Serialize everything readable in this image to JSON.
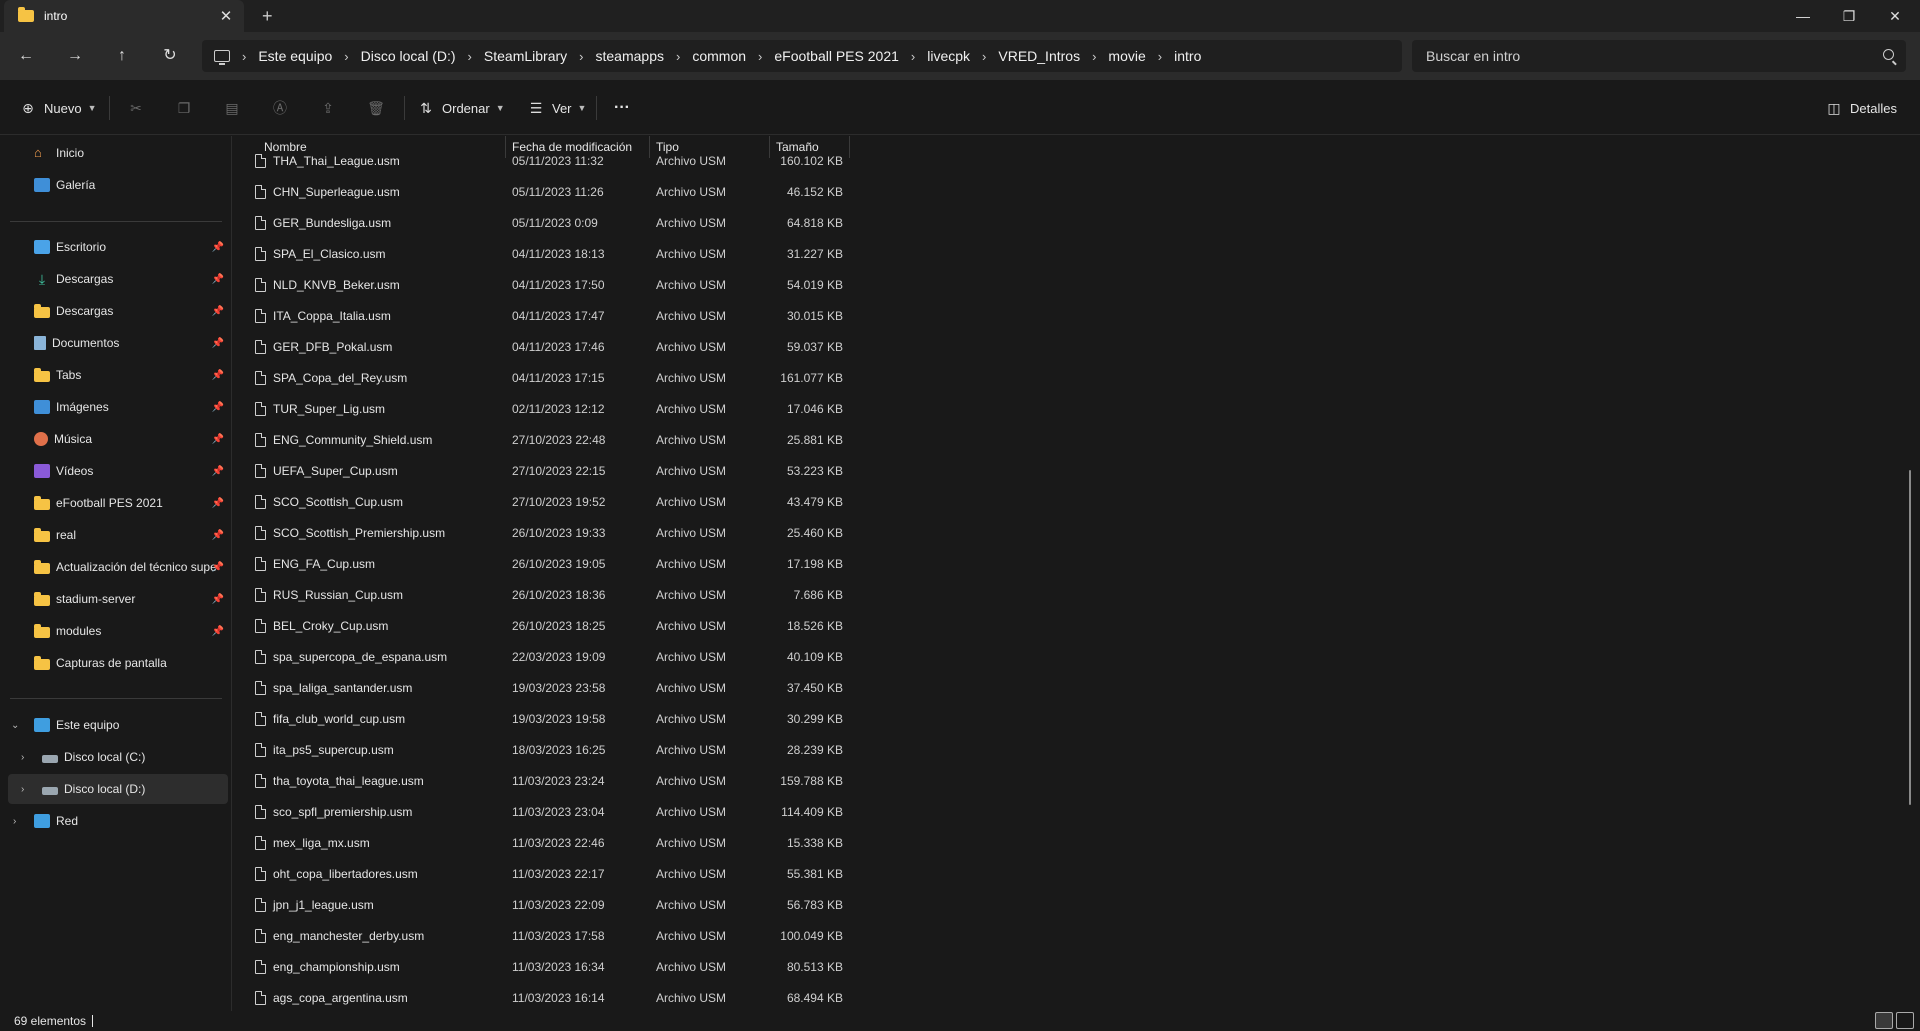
{
  "window": {
    "tab_title": "intro",
    "tab_close": "✕",
    "new_tab": "+",
    "minimize": "—",
    "maximize": "❐",
    "close": "✕"
  },
  "nav": {
    "back": "←",
    "forward": "→",
    "up": "↑",
    "refresh": "↻",
    "breadcrumbs": [
      "Este equipo",
      "Disco local (D:)",
      "SteamLibrary",
      "steamapps",
      "common",
      "eFootball PES 2021",
      "livecpk",
      "VRED_Intros",
      "movie",
      "intro"
    ],
    "search_placeholder": "Buscar en intro"
  },
  "toolbar": {
    "new_label": "Nuevo",
    "sort_label": "Ordenar",
    "view_label": "Ver",
    "more_label": "···",
    "details_label": "Detalles"
  },
  "sidebar": {
    "top": [
      {
        "label": "Inicio",
        "icon": "home-icon"
      },
      {
        "label": "Galería",
        "icon": "gallery-icon"
      }
    ],
    "quick": [
      {
        "label": "Escritorio",
        "icon": "desktop-icon"
      },
      {
        "label": "Descargas",
        "icon": "download-icon"
      },
      {
        "label": "Descargas",
        "icon": "folder-icon"
      },
      {
        "label": "Documentos",
        "icon": "documents-icon"
      },
      {
        "label": "Tabs",
        "icon": "folder-icon"
      },
      {
        "label": "Imágenes",
        "icon": "pictures-icon"
      },
      {
        "label": "Música",
        "icon": "music-icon"
      },
      {
        "label": "Vídeos",
        "icon": "videos-icon"
      },
      {
        "label": "eFootball PES 2021",
        "icon": "folder-icon"
      },
      {
        "label": "real",
        "icon": "folder-icon"
      },
      {
        "label": "Actualización del técnico supe",
        "icon": "folder-icon"
      },
      {
        "label": "stadium-server",
        "icon": "folder-icon"
      },
      {
        "label": "modules",
        "icon": "folder-icon"
      },
      {
        "label": "Capturas de pantalla",
        "icon": "folder-icon"
      }
    ],
    "tree": [
      {
        "label": "Este equipo",
        "icon": "pc-icon"
      },
      {
        "label": "Disco local (C:)",
        "icon": "drive-icon"
      },
      {
        "label": "Disco local (D:)",
        "icon": "drive-icon"
      },
      {
        "label": "Red",
        "icon": "network-icon"
      }
    ]
  },
  "columns": {
    "name": "Nombre",
    "date": "Fecha de modificación",
    "type": "Tipo",
    "size": "Tamaño"
  },
  "files": [
    {
      "name": "THA_Thai_League.usm",
      "date": "05/11/2023 11:32",
      "type": "Archivo USM",
      "size": "160.102 KB"
    },
    {
      "name": "CHN_Superleague.usm",
      "date": "05/11/2023 11:26",
      "type": "Archivo USM",
      "size": "46.152 KB"
    },
    {
      "name": "GER_Bundesliga.usm",
      "date": "05/11/2023 0:09",
      "type": "Archivo USM",
      "size": "64.818 KB"
    },
    {
      "name": "SPA_El_Clasico.usm",
      "date": "04/11/2023 18:13",
      "type": "Archivo USM",
      "size": "31.227 KB"
    },
    {
      "name": "NLD_KNVB_Beker.usm",
      "date": "04/11/2023 17:50",
      "type": "Archivo USM",
      "size": "54.019 KB"
    },
    {
      "name": "ITA_Coppa_Italia.usm",
      "date": "04/11/2023 17:47",
      "type": "Archivo USM",
      "size": "30.015 KB"
    },
    {
      "name": "GER_DFB_Pokal.usm",
      "date": "04/11/2023 17:46",
      "type": "Archivo USM",
      "size": "59.037 KB"
    },
    {
      "name": "SPA_Copa_del_Rey.usm",
      "date": "04/11/2023 17:15",
      "type": "Archivo USM",
      "size": "161.077 KB"
    },
    {
      "name": "TUR_Super_Lig.usm",
      "date": "02/11/2023 12:12",
      "type": "Archivo USM",
      "size": "17.046 KB"
    },
    {
      "name": "ENG_Community_Shield.usm",
      "date": "27/10/2023 22:48",
      "type": "Archivo USM",
      "size": "25.881 KB"
    },
    {
      "name": "UEFA_Super_Cup.usm",
      "date": "27/10/2023 22:15",
      "type": "Archivo USM",
      "size": "53.223 KB"
    },
    {
      "name": "SCO_Scottish_Cup.usm",
      "date": "27/10/2023 19:52",
      "type": "Archivo USM",
      "size": "43.479 KB"
    },
    {
      "name": "SCO_Scottish_Premiership.usm",
      "date": "26/10/2023 19:33",
      "type": "Archivo USM",
      "size": "25.460 KB"
    },
    {
      "name": "ENG_FA_Cup.usm",
      "date": "26/10/2023 19:05",
      "type": "Archivo USM",
      "size": "17.198 KB"
    },
    {
      "name": "RUS_Russian_Cup.usm",
      "date": "26/10/2023 18:36",
      "type": "Archivo USM",
      "size": "7.686 KB"
    },
    {
      "name": "BEL_Croky_Cup.usm",
      "date": "26/10/2023 18:25",
      "type": "Archivo USM",
      "size": "18.526 KB"
    },
    {
      "name": "spa_supercopa_de_espana.usm",
      "date": "22/03/2023 19:09",
      "type": "Archivo USM",
      "size": "40.109 KB"
    },
    {
      "name": "spa_laliga_santander.usm",
      "date": "19/03/2023 23:58",
      "type": "Archivo USM",
      "size": "37.450 KB"
    },
    {
      "name": "fifa_club_world_cup.usm",
      "date": "19/03/2023 19:58",
      "type": "Archivo USM",
      "size": "30.299 KB"
    },
    {
      "name": "ita_ps5_supercup.usm",
      "date": "18/03/2023 16:25",
      "type": "Archivo USM",
      "size": "28.239 KB"
    },
    {
      "name": "tha_toyota_thai_league.usm",
      "date": "11/03/2023 23:24",
      "type": "Archivo USM",
      "size": "159.788 KB"
    },
    {
      "name": "sco_spfl_premiership.usm",
      "date": "11/03/2023 23:04",
      "type": "Archivo USM",
      "size": "114.409 KB"
    },
    {
      "name": "mex_liga_mx.usm",
      "date": "11/03/2023 22:46",
      "type": "Archivo USM",
      "size": "15.338 KB"
    },
    {
      "name": "oht_copa_libertadores.usm",
      "date": "11/03/2023 22:17",
      "type": "Archivo USM",
      "size": "55.381 KB"
    },
    {
      "name": "jpn_j1_league.usm",
      "date": "11/03/2023 22:09",
      "type": "Archivo USM",
      "size": "56.783 KB"
    },
    {
      "name": "eng_manchester_derby.usm",
      "date": "11/03/2023 17:58",
      "type": "Archivo USM",
      "size": "100.049 KB"
    },
    {
      "name": "eng_championship.usm",
      "date": "11/03/2023 16:34",
      "type": "Archivo USM",
      "size": "80.513 KB"
    },
    {
      "name": "ags_copa_argentina.usm",
      "date": "11/03/2023 16:14",
      "type": "Archivo USM",
      "size": "68.494 KB"
    }
  ],
  "status": {
    "count": "69 elementos"
  },
  "colors": {
    "background": "#191919",
    "folder": "#f6c344",
    "selected": "#2d2d2d"
  }
}
